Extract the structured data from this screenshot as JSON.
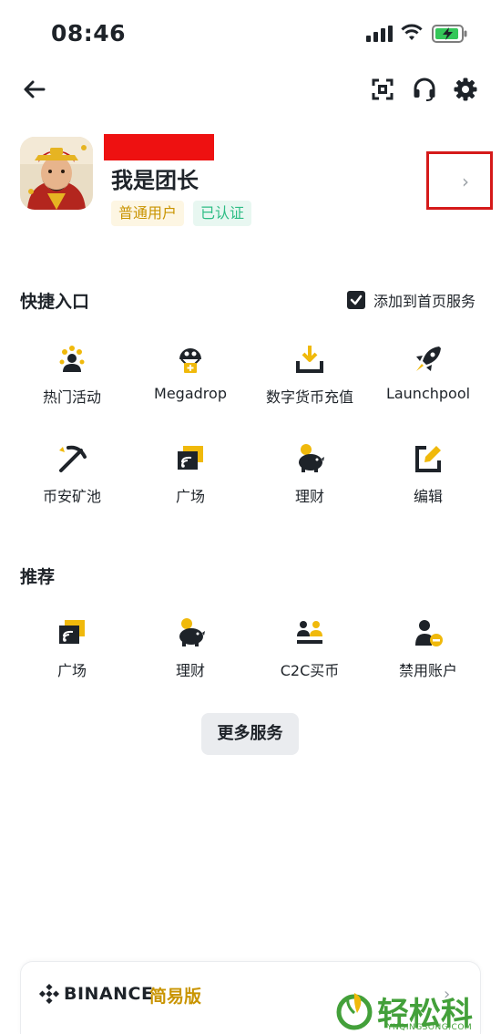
{
  "status_bar": {
    "time": "08:46"
  },
  "profile": {
    "nickname": "我是团长",
    "badges": [
      "普通用户",
      "已认证"
    ]
  },
  "quick_access": {
    "title": "快捷入口",
    "add_to_home_label": "添加到首页服务",
    "add_to_home_checked": true,
    "items": [
      {
        "label": "热门活动",
        "icon": "hot-activity-icon"
      },
      {
        "label": "Megadrop",
        "icon": "megadrop-icon"
      },
      {
        "label": "数字货币充值",
        "icon": "deposit-icon"
      },
      {
        "label": "Launchpool",
        "icon": "rocket-icon"
      },
      {
        "label": "币安矿池",
        "icon": "pickaxe-icon"
      },
      {
        "label": "广场",
        "icon": "square-feed-icon"
      },
      {
        "label": "理财",
        "icon": "piggy-bank-icon"
      },
      {
        "label": "编辑",
        "icon": "edit-icon"
      }
    ]
  },
  "recommended": {
    "title": "推荐",
    "items": [
      {
        "label": "广场",
        "icon": "square-feed-icon"
      },
      {
        "label": "理财",
        "icon": "piggy-bank-icon"
      },
      {
        "label": "C2C买币",
        "icon": "c2c-users-icon"
      },
      {
        "label": "禁用账户",
        "icon": "disable-account-icon"
      }
    ]
  },
  "more_services_label": "更多服务",
  "bottom_card": {
    "brand": "BINANCE",
    "mode": "简易版"
  },
  "watermark": {
    "text": "轻松科技",
    "url": "YNQINGSONG.COM"
  },
  "colors": {
    "accent": "#F0B90B",
    "dark": "#1E2329",
    "badge_gold": "#C99400",
    "badge_green": "#2EBD85",
    "highlight_red": "#D51A1A"
  }
}
